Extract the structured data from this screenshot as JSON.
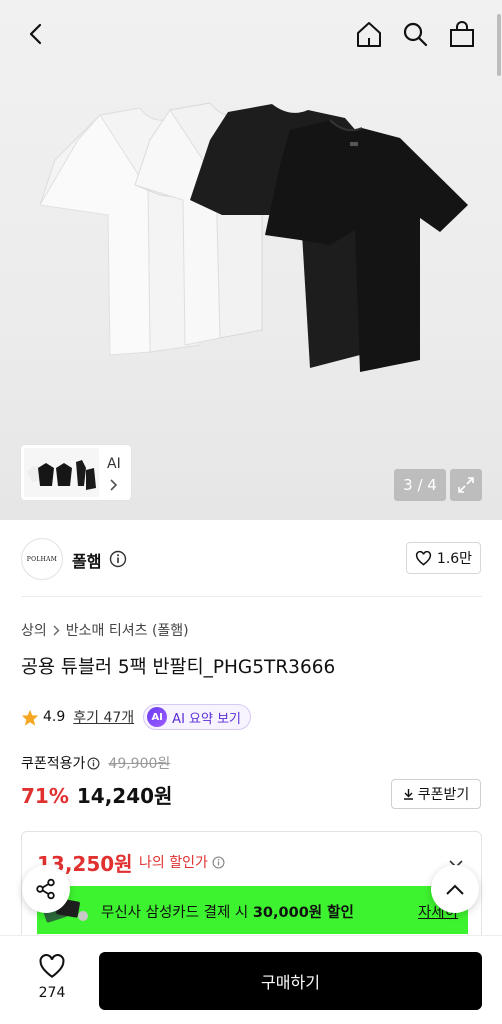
{
  "gallery": {
    "image_counter": "3 / 4",
    "thumbnail_label": "AI",
    "image_desc_icon": "tshirt-5pack"
  },
  "topbar": {
    "icons": [
      "back-arrow-icon",
      "home-icon",
      "search-icon",
      "shopping-bag-icon"
    ]
  },
  "brand": {
    "logo_text": "POLHAM",
    "name": "폴햄",
    "likes": "1.6만"
  },
  "product": {
    "breadcrumb": [
      "상의",
      "반소매 티셔츠 (폴햄)"
    ],
    "title": "공용 튜블러 5팩 반팔티_PHG5TR3666",
    "rating": "4.9",
    "review_link": "후기 47개",
    "ai_badge": "AI",
    "ai_summary": "AI 요약 보기"
  },
  "price": {
    "coupon_label": "쿠폰적용가",
    "original_price": "49,900원",
    "discount_rate": "71%",
    "sale_price": "14,240원",
    "coupon_button": "쿠폰받기"
  },
  "my_price": {
    "amount": "13,250원",
    "label": "나의 할인가",
    "banner_prefix": "무신사 삼성카드 결제 시 ",
    "banner_bold": "30,000원 할인",
    "banner_link": "자세히",
    "banner_color": "#3df22e"
  },
  "bottom": {
    "wish_count": "274",
    "buy_label": "구매하기"
  },
  "colors": {
    "accent_red": "#e0302f",
    "ai_purple": "#5b2fd8",
    "buy_button": "#000000"
  }
}
